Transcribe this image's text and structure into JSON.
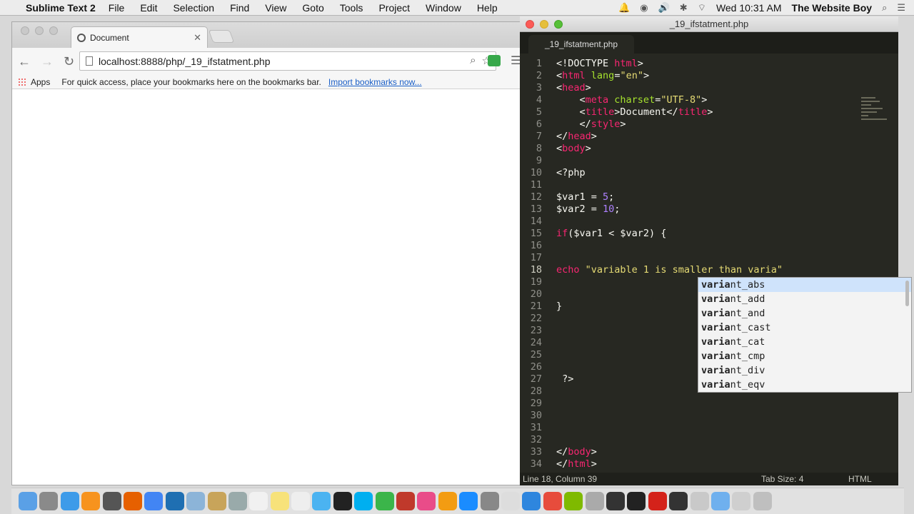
{
  "menubar": {
    "app_name": "Sublime Text 2",
    "items": [
      "File",
      "Edit",
      "Selection",
      "Find",
      "View",
      "Goto",
      "Tools",
      "Project",
      "Window",
      "Help"
    ],
    "clock": "Wed 10:31 AM",
    "user": "The Website Boy"
  },
  "browser": {
    "tab_title": "Document",
    "url": "localhost:8888/php/_19_ifstatment.php",
    "apps_label": "Apps",
    "bookmarks_hint": "For quick access, place your bookmarks here on the bookmarks bar.",
    "import_link": "Import bookmarks now..."
  },
  "sublime": {
    "window_title": "_19_ifstatment.php",
    "tab_label": "_19_ifstatment.php",
    "status": {
      "position": "Line 18, Column 39",
      "tab_size": "Tab Size: 4",
      "syntax": "HTML"
    }
  },
  "code_lines": [
    {
      "n": "1",
      "text": "<!DOCTYPE html>"
    },
    {
      "n": "2",
      "text": "<html lang=\"en\">"
    },
    {
      "n": "3",
      "text": "<head>"
    },
    {
      "n": "4",
      "text": "    <meta charset=\"UTF-8\">"
    },
    {
      "n": "5",
      "text": "    <title>Document</title>"
    },
    {
      "n": "6",
      "text": "    </style>"
    },
    {
      "n": "7",
      "text": "</head>"
    },
    {
      "n": "8",
      "text": "<body>"
    },
    {
      "n": "9",
      "text": ""
    },
    {
      "n": "10",
      "text": "<?php"
    },
    {
      "n": "11",
      "text": ""
    },
    {
      "n": "12",
      "text": "$var1 = 5;"
    },
    {
      "n": "13",
      "text": "$var2 = 10;"
    },
    {
      "n": "14",
      "text": ""
    },
    {
      "n": "15",
      "text": "if($var1 < $var2) {"
    },
    {
      "n": "16",
      "text": ""
    },
    {
      "n": "17",
      "text": ""
    },
    {
      "n": "18",
      "text": "echo \"variable 1 is smaller than varia\""
    },
    {
      "n": "19",
      "text": ""
    },
    {
      "n": "20",
      "text": ""
    },
    {
      "n": "21",
      "text": "}"
    },
    {
      "n": "22",
      "text": ""
    },
    {
      "n": "23",
      "text": ""
    },
    {
      "n": "24",
      "text": ""
    },
    {
      "n": "25",
      "text": ""
    },
    {
      "n": "26",
      "text": ""
    },
    {
      "n": "27",
      "text": " ?>"
    },
    {
      "n": "28",
      "text": ""
    },
    {
      "n": "29",
      "text": ""
    },
    {
      "n": "30",
      "text": ""
    },
    {
      "n": "31",
      "text": ""
    },
    {
      "n": "32",
      "text": ""
    },
    {
      "n": "33",
      "text": "</body>"
    },
    {
      "n": "34",
      "text": "</html>"
    }
  ],
  "current_line": "18",
  "autocomplete": {
    "typed": "varia",
    "items": [
      "variant_abs",
      "variant_add",
      "variant_and",
      "variant_cast",
      "variant_cat",
      "variant_cmp",
      "variant_div",
      "variant_eqv"
    ]
  },
  "dock_icons": [
    "finder-icon",
    "launchpad-icon",
    "safari-icon",
    "illustrator-icon",
    "filmstrip-icon",
    "firefox-icon",
    "chrome-icon",
    "photoshop-icon",
    "preview-icon",
    "folder-icon",
    "help-icon",
    "calendar-icon",
    "notes-icon",
    "reminders-icon",
    "messages-icon",
    "terminal-icon",
    "skype-icon",
    "facetime-icon",
    "game-icon",
    "itunes-icon",
    "ibooks-icon",
    "app-store-icon",
    "system-preferences-icon",
    "textedit-icon",
    "photo-icon",
    "colors-icon",
    "dreamweaver-icon",
    "utility-icon",
    "github-icon",
    "console-icon",
    "acrobat-icon",
    "kindle-icon",
    "dictionary-icon",
    "downloads-folder-icon",
    "documents-icon",
    "trash-icon"
  ]
}
